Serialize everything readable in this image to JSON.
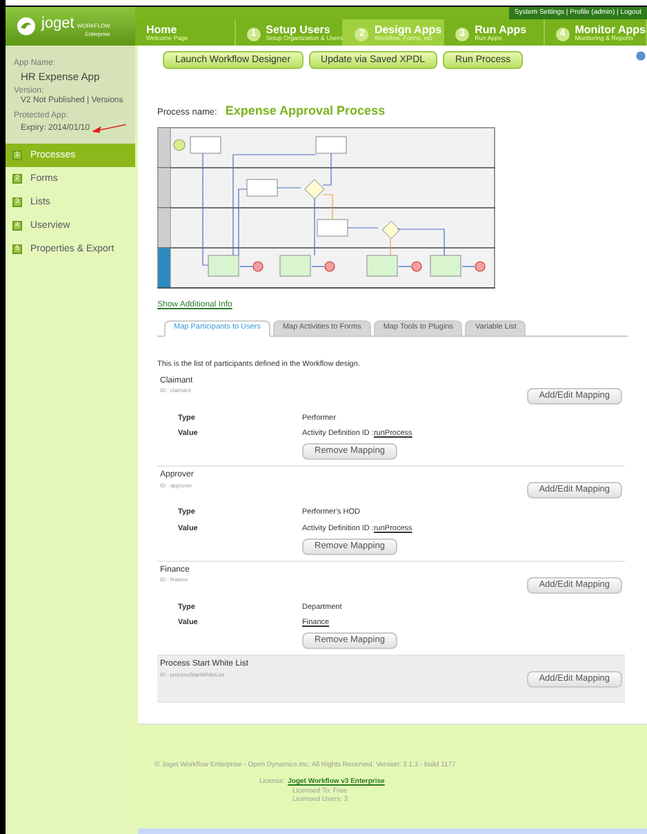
{
  "header": {
    "logo": {
      "name": "joget",
      "product": "WORKFLOW",
      "edition": "Enterprise"
    },
    "steps": [
      {
        "title": "Home",
        "subtitle": "Welcome Page",
        "selected": false
      },
      {
        "number": "1",
        "title": "Setup Users",
        "subtitle": "Setup Organization & Users",
        "selected": false
      },
      {
        "number": "2",
        "title": "Design Apps",
        "subtitle": "Workflow, Forms, etc",
        "selected": true
      },
      {
        "number": "3",
        "title": "Run Apps",
        "subtitle": "Run Apps",
        "selected": false
      },
      {
        "number": "4",
        "title": "Monitor Apps",
        "subtitle": "Monitoring & Reports",
        "selected": false
      }
    ],
    "user_links": "System Settings | Profile (admin) | Logout"
  },
  "sidebar": {
    "app_name_label": "App Name:",
    "app_name": "HR Expense App",
    "version_label": "Version:",
    "version": "V2 Not Published | Versions",
    "protected_label": "Protected App:",
    "expiry": "Expiry: 2014/01/10",
    "menu": [
      {
        "number": "1",
        "label": "Processes",
        "selected": true
      },
      {
        "number": "2",
        "label": "Forms",
        "selected": false
      },
      {
        "number": "3",
        "label": "Lists",
        "selected": false
      },
      {
        "number": "4",
        "label": "Userview",
        "selected": false
      },
      {
        "number": "5",
        "label": "Properties & Export",
        "selected": false
      }
    ]
  },
  "toolbar": [
    "Launch Workflow Designer",
    "Update via Saved XPDL",
    "Run Process"
  ],
  "process": {
    "label": "Process name:",
    "name": "Expense Approval Process"
  },
  "show_info": "Show Additional Info",
  "tabs": [
    {
      "label": "Map Participants to Users",
      "selected": true
    },
    {
      "label": "Map Activities to Forms",
      "selected": false
    },
    {
      "label": "Map Tools to Plugins",
      "selected": false
    },
    {
      "label": "Variable List",
      "selected": false
    }
  ],
  "intro": "This is the list of participants defined in the Workflow design.",
  "participants": [
    {
      "name": "Claimant",
      "id": "ID : claimant",
      "button": "Add/Edit Mapping",
      "highlighted": false,
      "mapping": {
        "type_label": "Type",
        "type": "Performer",
        "value_label": "Value",
        "value_prefix": "Activity Definition ID : ",
        "value_link": "runProcess",
        "remove": "Remove Mapping"
      }
    },
    {
      "name": "Approver",
      "id": "ID : approver",
      "button": "Add/Edit Mapping",
      "highlighted": false,
      "mapping": {
        "type_label": "Type",
        "type": "Performer's HOD",
        "value_label": "Value",
        "value_prefix": "Activity Definition ID : ",
        "value_link": "runProcess",
        "remove": "Remove Mapping"
      }
    },
    {
      "name": "Finance",
      "id": "ID : finance",
      "button": "Add/Edit Mapping",
      "highlighted": false,
      "mapping": {
        "type_label": "Type",
        "type": "Department",
        "value_label": "Value",
        "value_link": "Finance",
        "remove": "Remove Mapping"
      }
    },
    {
      "name": "Process Start White List",
      "id": "ID : processStartWhiteList",
      "button": "Add/Edit Mapping",
      "highlighted": true
    }
  ],
  "footer": {
    "copyright": "© Joget Workflow Enterprise - Open Dynamics Inc. All Rights Reserved. Version: 3.1.3 - build 1177",
    "license_label": "License:",
    "license": "Joget Workflow v3 Enterprise",
    "licensed_to": "Licensed To: Free",
    "licensed_users": "Licensed Users: 3"
  }
}
